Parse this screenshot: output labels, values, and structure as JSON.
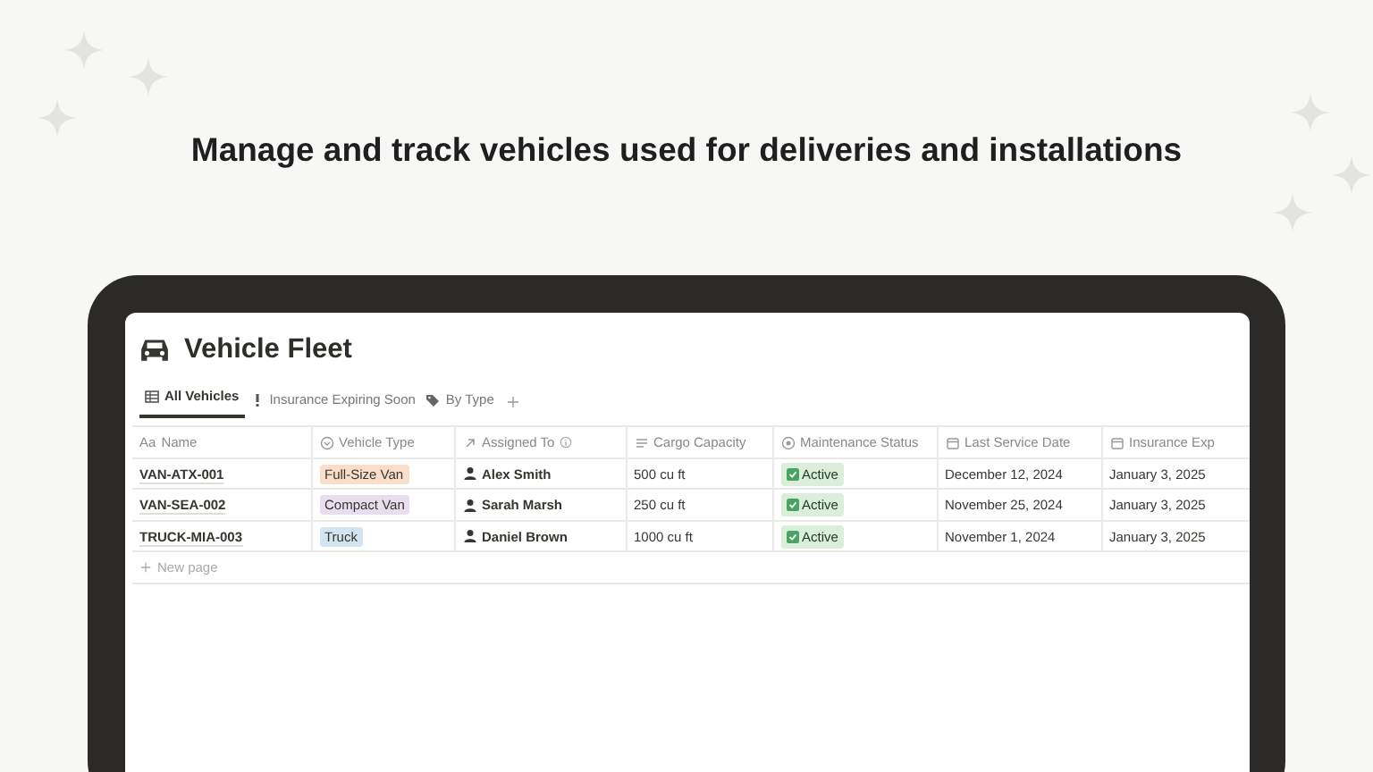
{
  "headline": "Manage and track vehicles used for deliveries and installations",
  "page": {
    "title": "Vehicle Fleet"
  },
  "views": [
    {
      "label": "All Vehicles",
      "kind": "table",
      "selected": true
    },
    {
      "label": "Insurance Expiring Soon",
      "kind": "alert",
      "selected": false
    },
    {
      "label": "By Type",
      "kind": "tag",
      "selected": false
    }
  ],
  "columns": [
    {
      "label": "Name",
      "kind": "title",
      "icon_text": "Aa"
    },
    {
      "label": "Vehicle Type",
      "kind": "select"
    },
    {
      "label": "Assigned To",
      "kind": "relation",
      "info": true
    },
    {
      "label": "Cargo Capacity",
      "kind": "text"
    },
    {
      "label": "Maintenance Status",
      "kind": "status"
    },
    {
      "label": "Last Service Date",
      "kind": "date"
    },
    {
      "label": "Insurance Exp",
      "kind": "date"
    }
  ],
  "rows": [
    {
      "name": "VAN-ATX-001",
      "type": {
        "label": "Full-Size Van",
        "color": "#fadec9"
      },
      "assigned": "Alex Smith",
      "cargo": "500 cu ft",
      "status": {
        "label": "Active",
        "checked": true
      },
      "last_service": "December 12, 2024",
      "insurance": "January 3, 2025"
    },
    {
      "name": "VAN-SEA-002",
      "type": {
        "label": "Compact Van",
        "color": "#e8deee"
      },
      "assigned": "Sarah Marsh",
      "cargo": "250 cu ft",
      "status": {
        "label": "Active",
        "checked": true
      },
      "last_service": "November 25, 2024",
      "insurance": "January 3, 2025"
    },
    {
      "name": "TRUCK-MIA-003",
      "type": {
        "label": "Truck",
        "color": "#d3e5ef"
      },
      "assigned": "Daniel Brown",
      "cargo": "1000 cu ft",
      "status": {
        "label": "Active",
        "checked": true
      },
      "last_service": "November 1, 2024",
      "insurance": "January 3, 2025"
    }
  ],
  "new_row": "New page"
}
